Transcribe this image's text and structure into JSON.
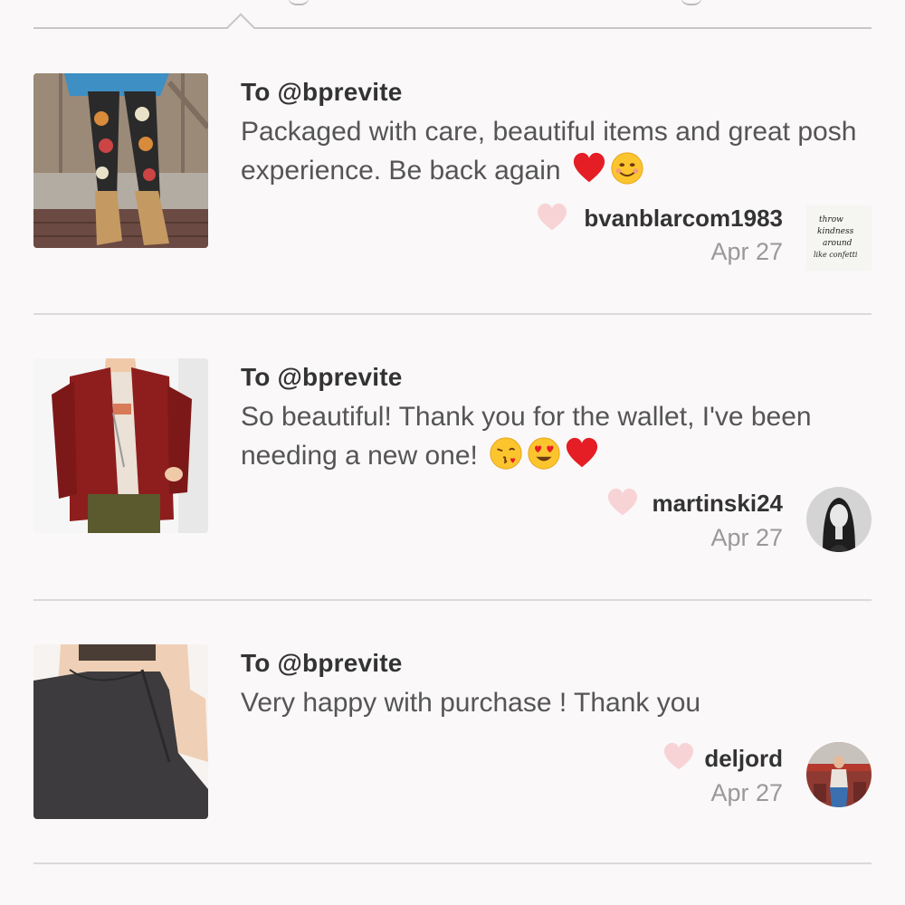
{
  "reviews": [
    {
      "to": "To @bprevite",
      "comment": "Packaged with care, beautiful items and great posh experience. Be back again",
      "emojis": [
        "red-heart-icon",
        "smiling-face-icon"
      ],
      "username": "bvanblarcom1983",
      "date": "Apr 27",
      "avatar_text": [
        "throw",
        "kindness",
        "around",
        "like confetti"
      ]
    },
    {
      "to": "To @bprevite",
      "comment": "So beautiful! Thank you for the wallet, I've been needing a new one!",
      "emojis": [
        "face-blowing-kiss-icon",
        "heart-eyes-face-icon",
        "red-heart-icon"
      ],
      "username": "martinski24",
      "date": "Apr 27"
    },
    {
      "to": "To @bprevite",
      "comment": "Very happy with purchase ! Thank you",
      "emojis": [],
      "username": "deljord",
      "date": "Apr 27"
    }
  ],
  "colors": {
    "like_heart": "#f8d3d6",
    "divider": "#dcd9db",
    "background": "#faf8f9"
  }
}
